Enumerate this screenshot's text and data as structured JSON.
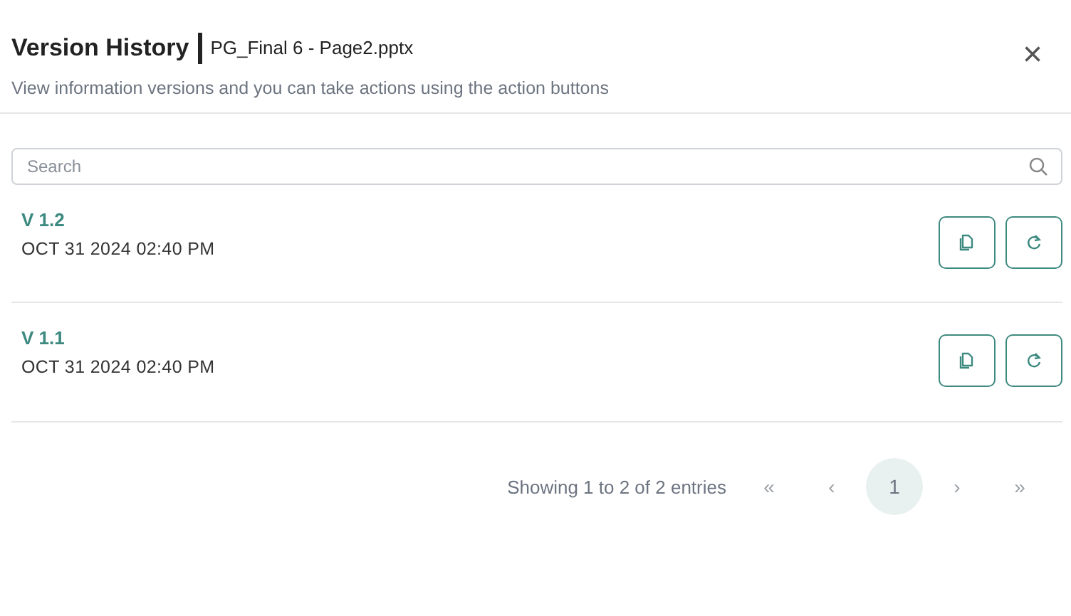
{
  "header": {
    "title": "Version History",
    "file_name": "PG_Final 6 - Page2.pptx",
    "subtitle": "View information versions and you can take actions using the action buttons",
    "close": "×"
  },
  "search": {
    "placeholder": "Search"
  },
  "versions": [
    {
      "version": "V 1.2",
      "date": "OCT 31 2024 02:40 PM"
    },
    {
      "version": "V 1.1",
      "date": "OCT 31 2024 02:40 PM"
    }
  ],
  "pagination": {
    "summary": "Showing 1 to 2 of 2 entries",
    "controls": [
      {
        "label": "«",
        "kind": "first"
      },
      {
        "label": "‹",
        "kind": "prev"
      },
      {
        "label": "1",
        "kind": "page",
        "selected": true
      },
      {
        "label": "›",
        "kind": "next"
      },
      {
        "label": "»",
        "kind": "last"
      }
    ]
  }
}
